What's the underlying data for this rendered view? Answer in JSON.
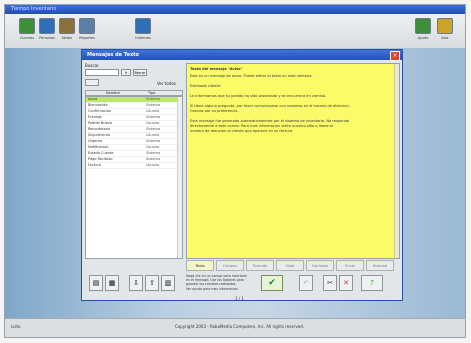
{
  "app": {
    "title": "Tiempo Inventario",
    "toolbar": [
      {
        "label": "Cuentas",
        "icon": "accounts-icon",
        "color": "#3f8f3a"
      },
      {
        "label": "Personas",
        "icon": "people-icon",
        "color": "#2f6fb8"
      },
      {
        "label": "Notas",
        "icon": "notes-icon",
        "color": "#8b6f3c"
      },
      {
        "label": "Reportes",
        "icon": "reports-icon",
        "color": "#5b7fa6"
      },
      {
        "label": "Informes",
        "icon": "info-icon",
        "color": "#2f6fb8"
      },
      {
        "label": "Ayuda",
        "icon": "help-icon",
        "color": "#3f8f3a"
      },
      {
        "label": "Salir",
        "icon": "exit-icon",
        "color": "#c9a32a"
      }
    ],
    "status_left": "Listo",
    "status_center": "Copyright 2003 - RoboMedia Computers, Inc. All rights reserved."
  },
  "dialog": {
    "title": "Mensajes de Texto",
    "search_label": "Buscar",
    "search_value": "",
    "go_button": "Ir",
    "clear_button": "Borrar",
    "filter_label": "Ver todos",
    "columns": [
      "Nombre",
      "Tipo"
    ],
    "rows": [
      {
        "name": "Aviso",
        "type": "Sistema",
        "selected": true
      },
      {
        "name": "Bienvenida",
        "type": "Sistema",
        "selected": false
      },
      {
        "name": "Confirmacion",
        "type": "Usuario",
        "selected": false
      },
      {
        "name": "Entrega",
        "type": "Sistema",
        "selected": false
      },
      {
        "name": "Pedido Nuevo",
        "type": "Usuario",
        "selected": false
      },
      {
        "name": "Recordatorio",
        "type": "Sistema",
        "selected": false
      },
      {
        "name": "Seguimiento",
        "type": "Usuario",
        "selected": false
      },
      {
        "name": "Urgente",
        "type": "Sistema",
        "selected": false
      },
      {
        "name": "Notificacion",
        "type": "Usuario",
        "selected": false
      },
      {
        "name": "Estado Cuenta",
        "type": "Sistema",
        "selected": false
      },
      {
        "name": "Pago Recibido",
        "type": "Sistema",
        "selected": false
      },
      {
        "name": "Factura",
        "type": "Usuario",
        "selected": false
      }
    ],
    "text_title": "Texto del mensaje \"Aviso\"",
    "text_lines": [
      "Este es un mensaje de aviso. Puede editar el texto en esta ventana.",
      "",
      "Estimado cliente:",
      "",
      "Le informamos que su pedido ha sido procesado y se encuentra en camino.",
      "",
      "Si tiene alguna pregunta, por favor comuniquese con nosotros en el horario de atencion.",
      "Gracias por su preferencia.",
      "",
      "Este mensaje fue generado automaticamente por el sistema de inventario. No responda",
      "directamente a este correo. Para mas informacion visite nuestro sitio o llame al",
      "numero de atencion al cliente que aparece en su factura."
    ],
    "tabs": [
      "Texto",
      "Campos",
      "Formato",
      "Vista",
      "Opciones",
      "Envio",
      "Historial"
    ],
    "notes": [
      "Haga clic en un campo para insertarlo",
      "en el mensaje. Use los botones para",
      "guardar los cambios realizados.",
      "Ver ayuda para mas informacion"
    ],
    "ok_label": "✔",
    "page_indicator": "1 / 1"
  }
}
